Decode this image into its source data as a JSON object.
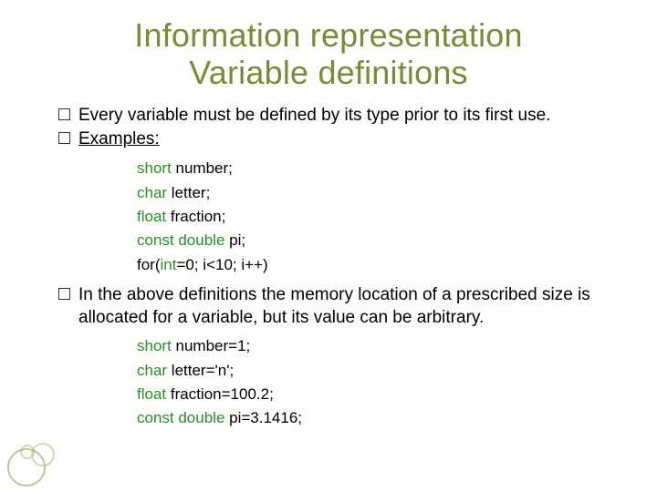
{
  "title_line1": "Information representation",
  "title_line2": "Variable definitions",
  "bullet1": "Every variable must be defined by its type prior to its first use.",
  "bullet2_label": "Examples:",
  "code1": {
    "l1_kw": "short",
    "l1_rest": " number;",
    "l2_kw": "char",
    "l2_rest": " letter;",
    "l3_kw": "float",
    "l3_rest": " fraction;",
    "l4_kw": "const double",
    "l4_rest": " pi;",
    "l5_a": "for(",
    "l5_kw": "int",
    "l5_b": "=0; i<10; i++)"
  },
  "bullet3": "In the above definitions the memory location of a prescribed size is allocated for a variable, but its value can be arbitrary.",
  "code2": {
    "l1_kw": "short",
    "l1_rest": " number=1;",
    "l2_kw": "char",
    "l2_rest": " letter='n';",
    "l3_kw": "float",
    "l3_rest": " fraction=100.2;",
    "l4_kw": "const double",
    "l4_rest": " pi=3.1416;"
  }
}
